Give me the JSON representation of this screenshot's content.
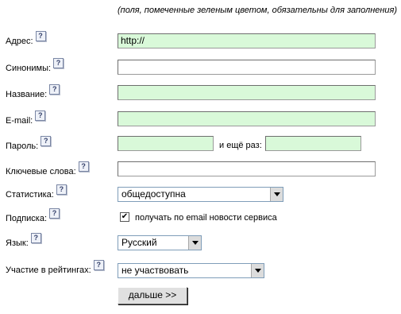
{
  "note": "(поля, помеченные зеленым цветом, обязательны для заполнения)",
  "help_glyph": "?",
  "labels": {
    "address": "Адрес:",
    "synonyms": "Синонимы:",
    "name": "Название:",
    "email": "E-mail:",
    "password": "Пароль:",
    "keywords": "Ключевые слова:",
    "statistics": "Статистика:",
    "subscription": "Подписка:",
    "language": "Язык:",
    "ratings": "Участие в рейтингах:"
  },
  "fields": {
    "address_value": "http://",
    "synonyms_value": "",
    "name_value": "",
    "email_value": "",
    "password_value": "",
    "password_repeat_value": "",
    "keywords_value": ""
  },
  "password_repeat_label": "и ещё раз:",
  "selects": {
    "statistics": "общедоступна",
    "language": "Русский",
    "ratings": "не участвовать"
  },
  "subscription": {
    "checked": true,
    "check_glyph": "✔",
    "label": "получать по email новости сервиса"
  },
  "submit_label": "дальше >>",
  "colors": {
    "required_field_bg": "#d9f9d9"
  },
  "icons": {
    "help": "question-mark-help-icon",
    "dropdown": "chevron-down-icon",
    "check": "checkmark-icon"
  }
}
